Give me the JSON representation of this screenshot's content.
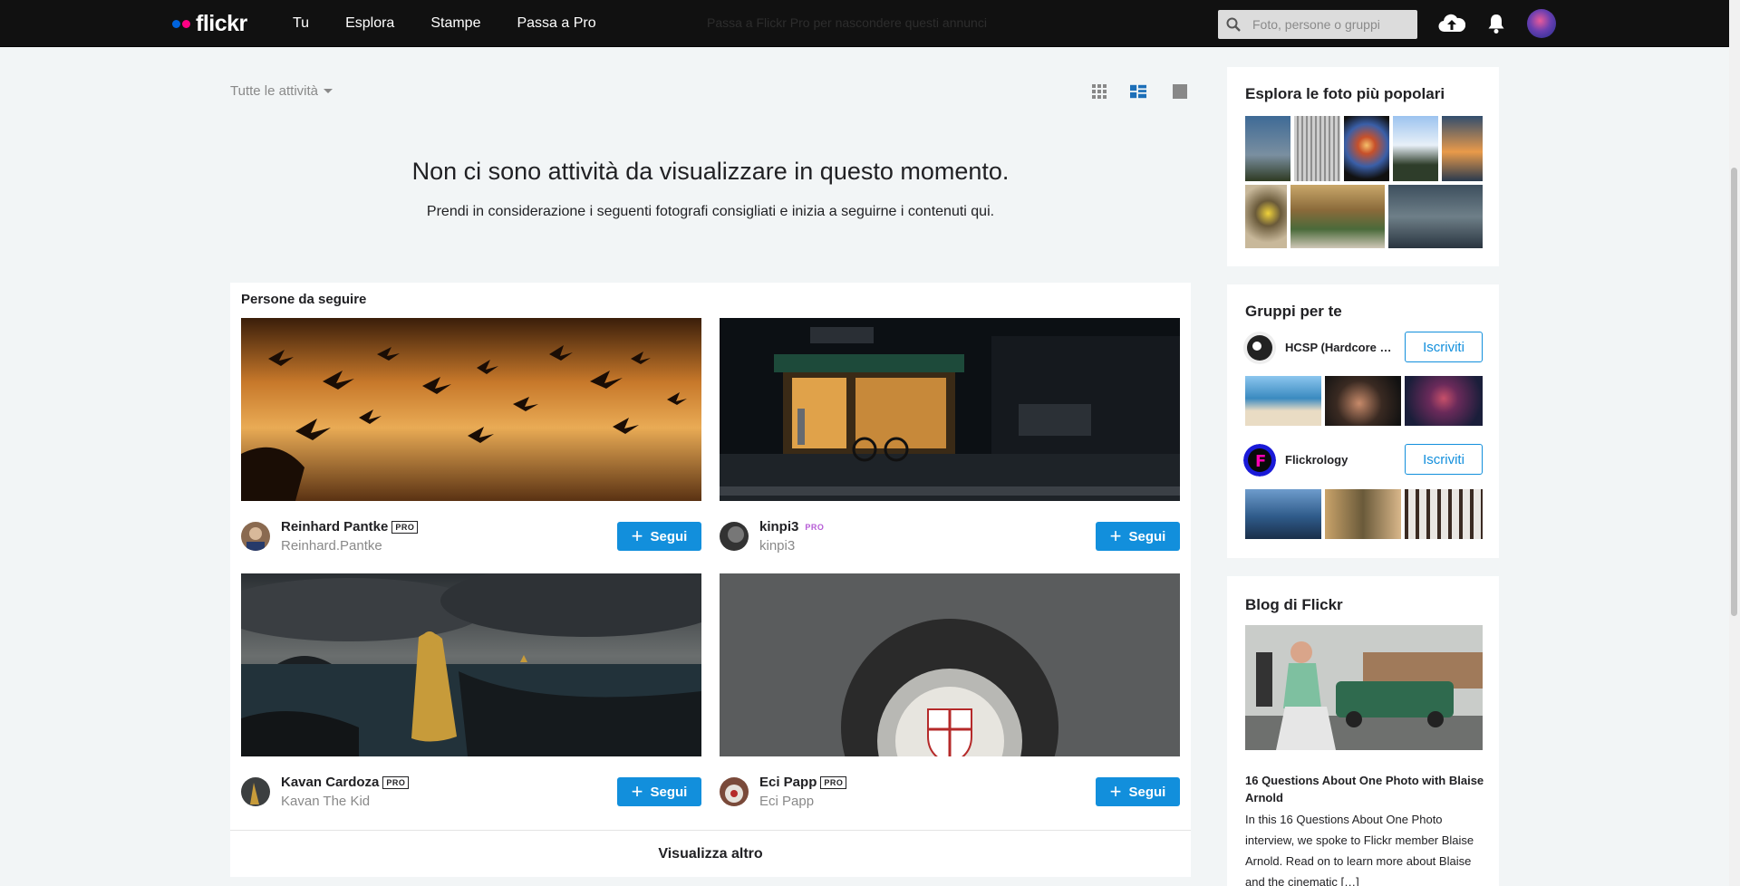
{
  "topbar": {
    "logo_text": "flickr",
    "nav": [
      "Tu",
      "Esplora",
      "Stampe",
      "Passa a Pro"
    ],
    "ad_text": "Passa a Flickr Pro per nascondere questi annunci",
    "search_placeholder": "Foto, persone o gruppi"
  },
  "feed": {
    "filter_label": "Tutte le attività",
    "empty_title": "Non ci sono attività da visualizzare in questo momento.",
    "empty_subtitle": "Prendi in considerazione i seguenti fotografi consigliati e inizia a seguirne i contenuti qui.",
    "people_heading": "Persone da seguire",
    "follow_label": "Segui",
    "more_label": "Visualizza altro",
    "people": [
      {
        "name": "Reinhard Pantke",
        "badge": "PRO",
        "username": "Reinhard.Pantke"
      },
      {
        "name": "kinpi3",
        "badge": "PRO",
        "username": "kinpi3"
      },
      {
        "name": "Kavan Cardoza",
        "badge": "PRO",
        "username": "Kavan The Kid"
      },
      {
        "name": "Eci Papp",
        "badge": "PRO",
        "username": "Eci Papp"
      }
    ]
  },
  "sidebar": {
    "popular_heading": "Esplora le foto più popolari",
    "groups_heading": "Gruppi per te",
    "join_label": "Iscriviti",
    "groups": [
      {
        "name": "HCSP (Hardcore Street Photography)"
      },
      {
        "name": "Flickrology"
      }
    ],
    "blog_heading": "Blog di Flickr",
    "blog_title": "16 Questions About One Photo with Blaise Arnold",
    "blog_excerpt": "In this 16 Questions About One Photo interview, we spoke to Flickr member Blaise Arnold. Read on to learn more about Blaise and the cinematic […]"
  },
  "colors": {
    "accent": "#128fdc",
    "topbar": "#111111",
    "background": "#f2f5f6"
  }
}
